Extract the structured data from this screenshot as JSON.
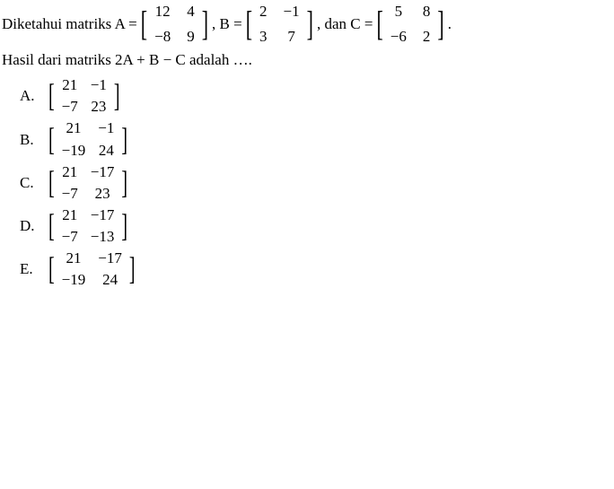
{
  "prompt": {
    "prefix": "Diketahui matriks A = ",
    "mid1": ", B = ",
    "mid2": ", dan C = ",
    "suffix": "."
  },
  "matrixA": {
    "r0c0": "12",
    "r0c1": "4",
    "r1c0": "−8",
    "r1c1": "9"
  },
  "matrixB": {
    "r0c0": "2",
    "r0c1": "−1",
    "r1c0": "3",
    "r1c1": "7"
  },
  "matrixC": {
    "r0c0": "5",
    "r0c1": "8",
    "r1c0": "−6",
    "r1c1": "2"
  },
  "question": "Hasil dari matriks  2A + B − C adalah ….",
  "options": [
    {
      "label": "A.",
      "m": {
        "r0c0": "21",
        "r0c1": "−1",
        "r1c0": "−7",
        "r1c1": "23"
      }
    },
    {
      "label": "B.",
      "m": {
        "r0c0": "21",
        "r0c1": "−1",
        "r1c0": "−19",
        "r1c1": "24"
      }
    },
    {
      "label": "C.",
      "m": {
        "r0c0": "21",
        "r0c1": "−17",
        "r1c0": "−7",
        "r1c1": "23"
      }
    },
    {
      "label": "D.",
      "m": {
        "r0c0": "21",
        "r0c1": "−17",
        "r1c0": "−7",
        "r1c1": "−13"
      }
    },
    {
      "label": "E.",
      "m": {
        "r0c0": "21",
        "r0c1": "−17",
        "r1c0": "−19",
        "r1c1": "24"
      }
    }
  ],
  "chart_data": {
    "type": "table",
    "title": "Matrix problem 2A + B − C",
    "A": [
      [
        12,
        4
      ],
      [
        -8,
        9
      ]
    ],
    "B": [
      [
        2,
        -1
      ],
      [
        3,
        7
      ]
    ],
    "C": [
      [
        5,
        8
      ],
      [
        -6,
        2
      ]
    ],
    "answer_choices": {
      "A": [
        [
          21,
          -1
        ],
        [
          -7,
          23
        ]
      ],
      "B": [
        [
          21,
          -1
        ],
        [
          -19,
          24
        ]
      ],
      "C": [
        [
          21,
          -17
        ],
        [
          -7,
          23
        ]
      ],
      "D": [
        [
          21,
          -17
        ],
        [
          -7,
          -13
        ]
      ],
      "E": [
        [
          21,
          -17
        ],
        [
          -19,
          24
        ]
      ]
    }
  }
}
